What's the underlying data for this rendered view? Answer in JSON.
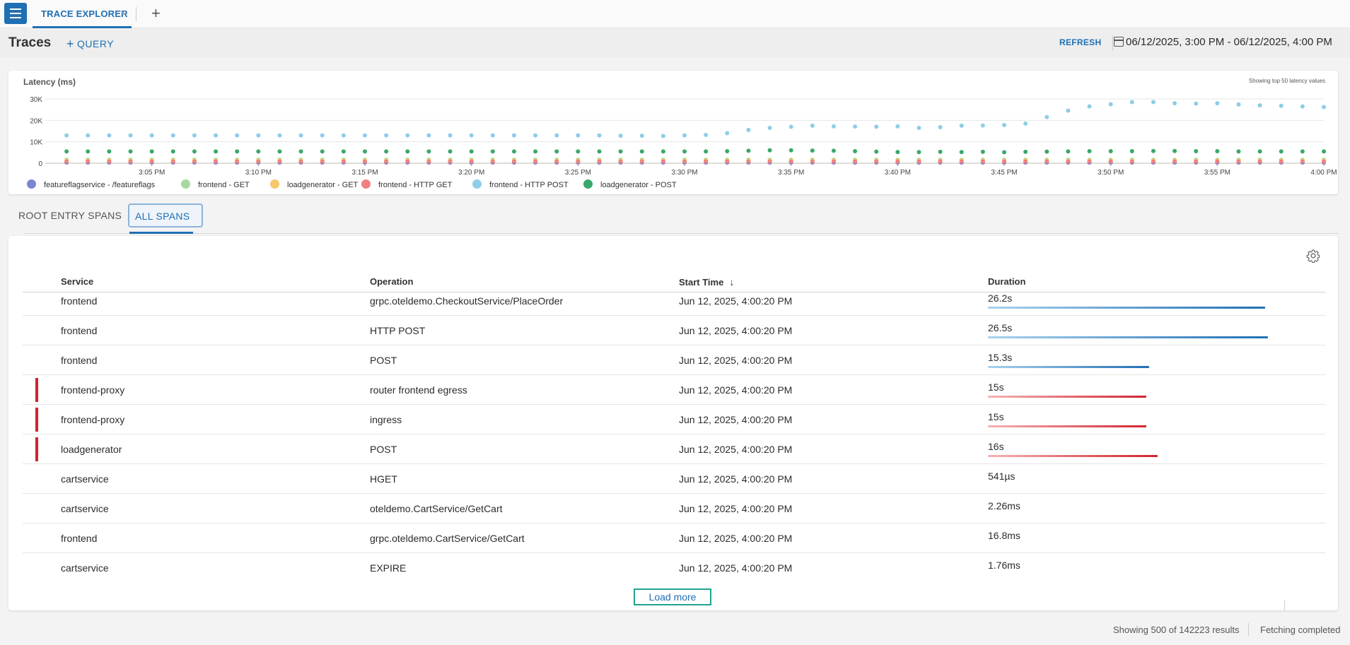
{
  "tabs": {
    "active_label": "TRACE EXPLORER",
    "close_glyph": "×",
    "add_glyph": "+"
  },
  "header": {
    "title": "Traces",
    "query_label": "QUERY",
    "refresh_label": "REFRESH",
    "date_range": "06/12/2025, 3:00 PM - 06/12/2025, 4:00 PM"
  },
  "chart_data": {
    "type": "scatter",
    "title": "Latency (ms)",
    "note": "Showing top 50 latency values",
    "ylim": [
      0,
      30000
    ],
    "xlim": [
      "2025-06-12 15:00",
      "2025-06-12 16:00"
    ],
    "y_ticks": [
      "0",
      "10K",
      "20K",
      "30K"
    ],
    "y_tick_values": [
      0,
      10000,
      20000,
      30000
    ],
    "x_ticks": [
      "3:05 PM",
      "3:10 PM",
      "3:15 PM",
      "3:20 PM",
      "3:25 PM",
      "3:30 PM",
      "3:35 PM",
      "3:40 PM",
      "3:45 PM",
      "3:50 PM",
      "3:55 PM",
      "4:00 PM"
    ],
    "x_tick_values": [
      5,
      10,
      15,
      20,
      25,
      30,
      35,
      40,
      45,
      50,
      55,
      60
    ],
    "grid": true,
    "legend_position": "bottom-left",
    "x": [
      1,
      2,
      3,
      4,
      5,
      6,
      7,
      8,
      9,
      10,
      11,
      12,
      13,
      14,
      15,
      16,
      17,
      18,
      19,
      20,
      21,
      22,
      23,
      24,
      25,
      26,
      27,
      28,
      29,
      30,
      31,
      32,
      33,
      34,
      35,
      36,
      37,
      38,
      39,
      40,
      41,
      42,
      43,
      44,
      45,
      46,
      47,
      48,
      49,
      50,
      51,
      52,
      53,
      54,
      55,
      56,
      57,
      58,
      59,
      60
    ],
    "series": [
      {
        "name": "featureflagservice -  /featureflags",
        "color": "#7b86d1",
        "values": [
          300,
          300,
          300,
          300,
          300,
          300,
          300,
          300,
          300,
          300,
          300,
          300,
          300,
          300,
          300,
          300,
          300,
          300,
          300,
          300,
          300,
          300,
          300,
          300,
          300,
          300,
          300,
          300,
          300,
          300,
          300,
          300,
          300,
          300,
          300,
          300,
          300,
          300,
          300,
          300,
          300,
          300,
          300,
          300,
          300,
          300,
          300,
          300,
          300,
          300,
          300,
          300,
          300,
          300,
          300,
          300,
          300,
          300,
          300,
          300
        ]
      },
      {
        "name": "frontend -  GET",
        "color": "#a8d89e",
        "values": [
          1600,
          1600,
          1600,
          1600,
          1600,
          1600,
          1600,
          1600,
          1600,
          1600,
          1600,
          1600,
          1600,
          1600,
          1600,
          1600,
          1600,
          1600,
          1600,
          1600,
          1600,
          1600,
          1600,
          1600,
          1600,
          1600,
          1600,
          1600,
          1600,
          1600,
          1600,
          1600,
          1600,
          1600,
          1600,
          1600,
          1600,
          1600,
          1600,
          1600,
          1600,
          1600,
          1600,
          1600,
          1600,
          1600,
          1600,
          1600,
          1600,
          1600,
          1600,
          1600,
          1600,
          1600,
          1600,
          1600,
          1600,
          1600,
          1600,
          1600
        ]
      },
      {
        "name": "loadgenerator -  GET",
        "color": "#f6c86b",
        "values": [
          1200,
          1200,
          1200,
          1200,
          1200,
          1200,
          1200,
          1200,
          1200,
          1200,
          1200,
          1200,
          1200,
          1200,
          1200,
          1200,
          1200,
          1200,
          1200,
          1200,
          1200,
          1200,
          1200,
          1200,
          1200,
          1200,
          1200,
          1200,
          1200,
          1200,
          1200,
          1200,
          1200,
          1200,
          1200,
          1200,
          1200,
          1200,
          1200,
          1200,
          1200,
          1200,
          1200,
          1200,
          1200,
          1200,
          1200,
          1200,
          1200,
          1200,
          1200,
          1200,
          1200,
          1200,
          1200,
          1200,
          1200,
          1200,
          1200,
          1200
        ]
      },
      {
        "name": "frontend -  HTTP GET",
        "color": "#f08080",
        "values": [
          800,
          800,
          800,
          800,
          800,
          800,
          800,
          800,
          800,
          800,
          800,
          800,
          800,
          800,
          800,
          800,
          800,
          800,
          800,
          800,
          800,
          800,
          800,
          800,
          800,
          800,
          800,
          800,
          800,
          800,
          800,
          800,
          800,
          800,
          800,
          800,
          800,
          800,
          800,
          800,
          800,
          800,
          800,
          800,
          800,
          800,
          800,
          800,
          800,
          800,
          800,
          800,
          800,
          800,
          800,
          800,
          800,
          800,
          800,
          800
        ]
      },
      {
        "name": "frontend -  HTTP POST",
        "color": "#8ecde6",
        "values": [
          13000,
          13000,
          13000,
          13000,
          13000,
          13000,
          13000,
          13000,
          13000,
          13000,
          13000,
          13000,
          13000,
          13000,
          13000,
          13000,
          13000,
          13000,
          13000,
          13000,
          13000,
          13000,
          13000,
          13000,
          13000,
          13000,
          12800,
          12800,
          12700,
          13000,
          13200,
          14000,
          15500,
          16500,
          17000,
          17500,
          17200,
          17100,
          17000,
          17200,
          16500,
          16800,
          17500,
          17600,
          17800,
          18500,
          21500,
          24500,
          26500,
          27500,
          28500,
          28500,
          28000,
          27800,
          28000,
          27400,
          27000,
          26800,
          26500,
          26200
        ]
      },
      {
        "name": "loadgenerator -  POST",
        "color": "#3aa76d",
        "values": [
          5500,
          5500,
          5500,
          5500,
          5500,
          5500,
          5500,
          5500,
          5500,
          5500,
          5500,
          5500,
          5500,
          5500,
          5500,
          5500,
          5500,
          5500,
          5500,
          5500,
          5500,
          5500,
          5500,
          5500,
          5500,
          5500,
          5500,
          5500,
          5500,
          5500,
          5500,
          5600,
          5800,
          6000,
          6000,
          5900,
          5800,
          5600,
          5400,
          5200,
          5200,
          5300,
          5200,
          5300,
          5100,
          5300,
          5400,
          5500,
          5600,
          5600,
          5600,
          5700,
          5700,
          5600,
          5600,
          5500,
          5500,
          5500,
          5500,
          5500
        ]
      }
    ]
  },
  "span_tabs": {
    "root_label": "ROOT ENTRY SPANS",
    "all_label": "ALL SPANS"
  },
  "table": {
    "headers": {
      "service": "Service",
      "operation": "Operation",
      "start_time": "Start Time",
      "duration": "Duration"
    },
    "rows": [
      {
        "service": "frontend",
        "operation": "grpc.oteldemo.CheckoutService/PlaceOrder",
        "start": "Jun 12, 2025, 4:00:20 PM",
        "duration": "26.2s",
        "fraction": 0.98,
        "error": false
      },
      {
        "service": "frontend",
        "operation": "HTTP POST",
        "start": "Jun 12, 2025, 4:00:20 PM",
        "duration": "26.5s",
        "fraction": 0.99,
        "error": false
      },
      {
        "service": "frontend",
        "operation": "POST",
        "start": "Jun 12, 2025, 4:00:20 PM",
        "duration": "15.3s",
        "fraction": 0.57,
        "error": false
      },
      {
        "service": "frontend-proxy",
        "operation": "router frontend egress",
        "start": "Jun 12, 2025, 4:00:20 PM",
        "duration": "15s",
        "fraction": 0.56,
        "error": true
      },
      {
        "service": "frontend-proxy",
        "operation": "ingress",
        "start": "Jun 12, 2025, 4:00:20 PM",
        "duration": "15s",
        "fraction": 0.56,
        "error": true
      },
      {
        "service": "loadgenerator",
        "operation": "POST",
        "start": "Jun 12, 2025, 4:00:20 PM",
        "duration": "16s",
        "fraction": 0.6,
        "error": true
      },
      {
        "service": "cartservice",
        "operation": "HGET",
        "start": "Jun 12, 2025, 4:00:20 PM",
        "duration": "541µs",
        "fraction": 0,
        "error": false
      },
      {
        "service": "cartservice",
        "operation": "oteldemo.CartService/GetCart",
        "start": "Jun 12, 2025, 4:00:20 PM",
        "duration": "2.26ms",
        "fraction": 0,
        "error": false
      },
      {
        "service": "frontend",
        "operation": "grpc.oteldemo.CartService/GetCart",
        "start": "Jun 12, 2025, 4:00:20 PM",
        "duration": "16.8ms",
        "fraction": 0,
        "error": false
      },
      {
        "service": "cartservice",
        "operation": "EXPIRE",
        "start": "Jun 12, 2025, 4:00:20 PM",
        "duration": "1.76ms",
        "fraction": 0,
        "error": false
      }
    ],
    "load_more_label": "Load more"
  },
  "colors": {
    "accent": "#1f6fb4",
    "error": "#d1242f",
    "load_more_border": "#20a58f"
  },
  "footer": {
    "results": "Showing 500 of 142223 results",
    "status": "Fetching completed"
  }
}
